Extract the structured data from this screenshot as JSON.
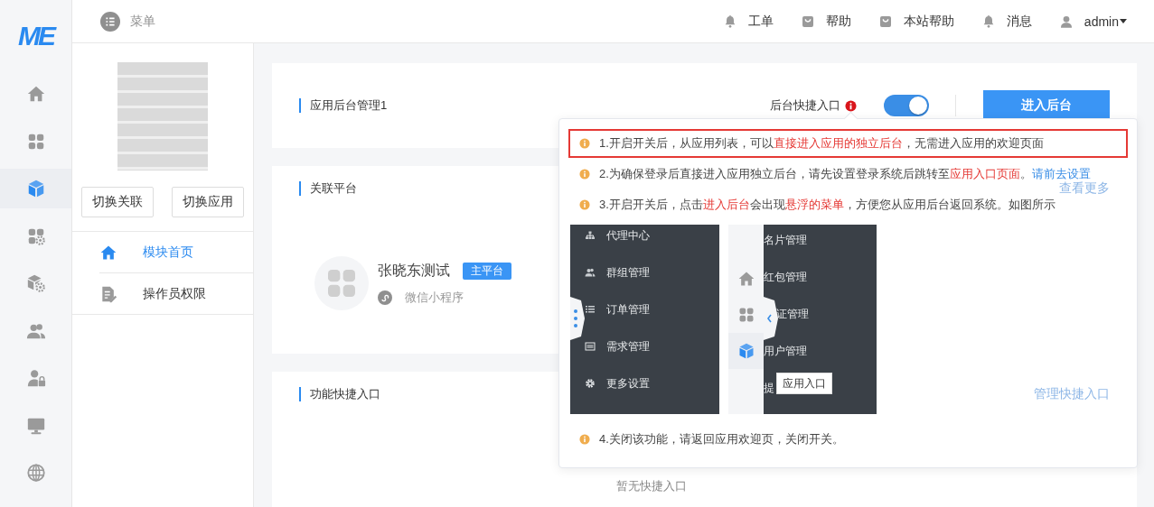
{
  "rail": {
    "logo": "ME",
    "items": [
      {
        "kind": "home",
        "selected": false
      },
      {
        "kind": "grid",
        "selected": false
      },
      {
        "kind": "cube",
        "selected": true
      },
      {
        "kind": "grid-gear",
        "selected": false
      },
      {
        "kind": "cube-gear",
        "selected": false
      },
      {
        "kind": "users",
        "selected": false
      },
      {
        "kind": "user-lock",
        "selected": false
      },
      {
        "kind": "monitor",
        "selected": false
      },
      {
        "kind": "globe",
        "selected": false
      }
    ]
  },
  "header": {
    "menu_label": "菜单",
    "links": [
      {
        "kind": "bell",
        "label": "工单"
      },
      {
        "kind": "bag",
        "label": "帮助"
      },
      {
        "kind": "bag",
        "label": "本站帮助"
      },
      {
        "kind": "bell",
        "label": "消息"
      },
      {
        "kind": "user",
        "label": "admin"
      }
    ]
  },
  "app_panel": {
    "buttons": [
      "切换关联",
      "切换应用"
    ],
    "menu": [
      {
        "kind": "home",
        "label": "模块首页",
        "selected": true
      },
      {
        "kind": "doc",
        "label": "操作员权限",
        "selected": false
      }
    ]
  },
  "backend_card": {
    "title": "应用后台管理1",
    "shortcut_label": "后台快捷入口",
    "shortcut_on": true,
    "button": "进入后台"
  },
  "platform_card": {
    "title": "关联平台",
    "more_link": "查看更多",
    "platform": {
      "name": "张晓东测试",
      "badge": "主平台",
      "type": "微信小程序"
    }
  },
  "shortcut_card": {
    "title": "功能快捷入口",
    "manage_link": "管理快捷入口",
    "empty_text": "暂无快捷入口"
  },
  "popover": {
    "notes": [
      {
        "highlighted": true,
        "parts": [
          {
            "kind": "plain",
            "text": "1.开启开关后，从应用列表，可以"
          },
          {
            "kind": "red",
            "text": "直接进入应用的独立后台"
          },
          {
            "kind": "plain",
            "text": "，无需进入应用的欢迎页面"
          }
        ]
      },
      {
        "highlighted": false,
        "parts": [
          {
            "kind": "plain",
            "text": "2.为确保登录后直接进入应用独立后台，请先设置登录系统后跳转至"
          },
          {
            "kind": "red",
            "text": "应用入口页面"
          },
          {
            "kind": "plain",
            "text": "。"
          },
          {
            "kind": "link",
            "text": "请前去设置"
          }
        ]
      },
      {
        "highlighted": false,
        "parts": [
          {
            "kind": "plain",
            "text": "3.开启开关后，点击"
          },
          {
            "kind": "red",
            "text": "进入后台"
          },
          {
            "kind": "plain",
            "text": "会出现"
          },
          {
            "kind": "red",
            "text": "悬浮的菜单"
          },
          {
            "kind": "plain",
            "text": "，方便您从应用后台返回系统。如图所示"
          }
        ]
      },
      {
        "highlighted": false,
        "parts": [
          {
            "kind": "plain",
            "text": "4.关闭该功能，请返回应用欢迎页，关闭开关。"
          }
        ]
      }
    ],
    "example": {
      "left_menu": [
        {
          "kind": "sitemap",
          "label": "代理中心"
        },
        {
          "kind": "users",
          "label": "群组管理"
        },
        {
          "kind": "list",
          "label": "订单管理"
        },
        {
          "kind": "card",
          "label": "需求管理"
        },
        {
          "kind": "gear",
          "label": "更多设置"
        }
      ],
      "rail_items": [
        {
          "kind": "home",
          "selected": false
        },
        {
          "kind": "grid",
          "selected": false
        },
        {
          "kind": "cube",
          "selected": true
        }
      ],
      "right_menu": [
        "名片管理",
        "红包管理",
        "证管理",
        "用户管理",
        "提"
      ],
      "tooltip": "应用入口"
    }
  }
}
